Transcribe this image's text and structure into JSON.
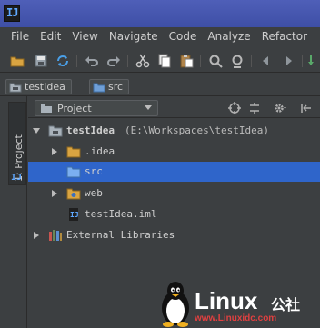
{
  "window": {
    "logo_text": "IJ"
  },
  "menu": [
    "File",
    "Edit",
    "View",
    "Navigate",
    "Code",
    "Analyze",
    "Refactor"
  ],
  "toolbar_icons": [
    "open-folder-icon",
    "save-all-icon",
    "synchronize-icon",
    "undo-icon",
    "redo-icon",
    "cut-icon",
    "copy-icon",
    "paste-icon",
    "find-icon",
    "replace-icon",
    "back-icon",
    "forward-icon",
    "build-icon"
  ],
  "breadcrumbs": [
    {
      "label": "testIdea",
      "icon": "project-folder-icon"
    },
    {
      "label": "src",
      "icon": "source-folder-icon"
    }
  ],
  "tool_window": {
    "tab_label": "1: Project",
    "view_selector": "Project",
    "header_icons": [
      "locate-icon",
      "collapse-all-icon",
      "settings-icon",
      "hide-icon"
    ]
  },
  "tree": [
    {
      "label": "testIdea",
      "path": "(E:\\Workspaces\\testIdea)",
      "level": 0,
      "expanded": true,
      "icon": "project-folder-icon",
      "selected": false
    },
    {
      "label": ".idea",
      "level": 1,
      "expanded": false,
      "icon": "folder-icon",
      "selected": false
    },
    {
      "label": "src",
      "level": 1,
      "expanded": null,
      "icon": "source-folder-icon",
      "selected": true
    },
    {
      "label": "web",
      "level": 1,
      "expanded": false,
      "icon": "web-folder-icon",
      "selected": false
    },
    {
      "label": "testIdea.iml",
      "level": 1,
      "expanded": null,
      "icon": "iml-file-icon",
      "selected": false
    },
    {
      "label": "External Libraries",
      "level": 0,
      "expanded": false,
      "icon": "libraries-icon",
      "selected": false
    }
  ],
  "watermark": {
    "brand": "Linux",
    "brand_cn": "公社",
    "url": "www.Linuxidc.com"
  },
  "colors": {
    "selection": "#2f65ca",
    "titlebar": "#4456ad",
    "background": "#3c3f41"
  }
}
